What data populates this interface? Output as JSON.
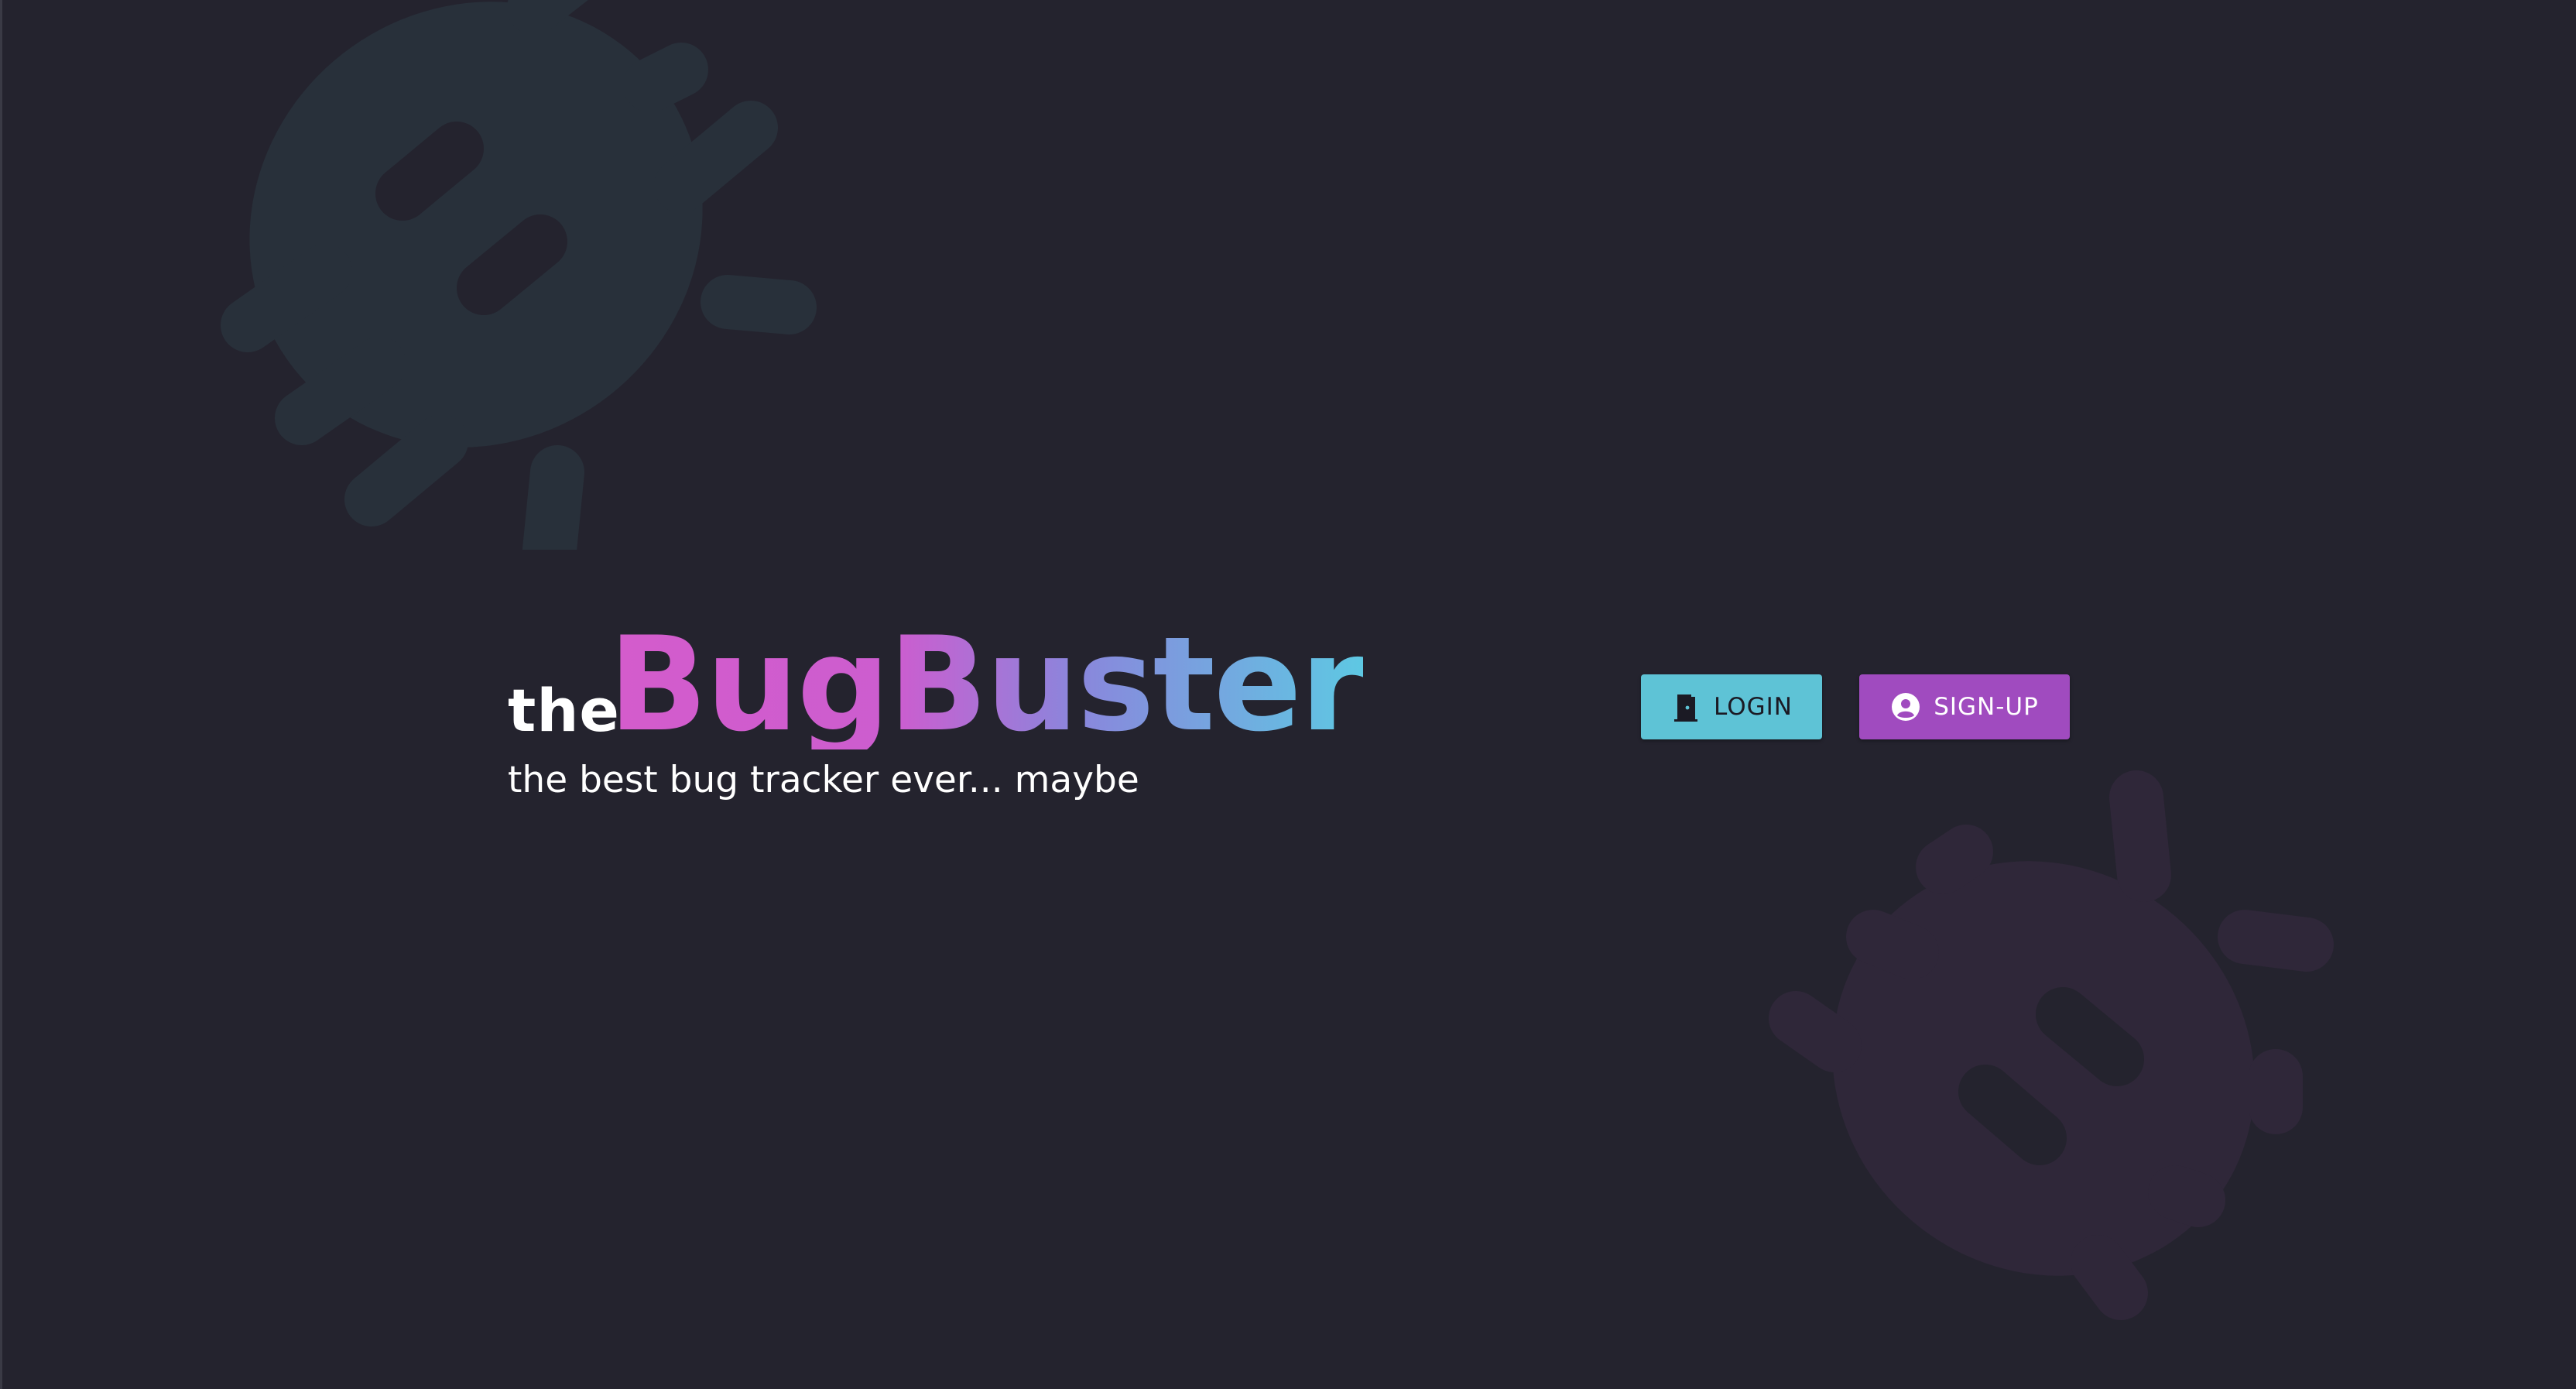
{
  "brand": {
    "prefix": "the",
    "name": "BugBuster",
    "tagline": "the best bug tracker ever... maybe",
    "gradient": [
      "#d45ccc",
      "#cc5dcf",
      "#8a86dc",
      "#5ec8e3"
    ]
  },
  "actions": {
    "login": {
      "label": "LOGIN",
      "icon": "door-icon",
      "color": "#5ec3d6"
    },
    "signup": {
      "label": "SIGN-UP",
      "icon": "account-circle-icon",
      "color": "#a04bbf"
    }
  },
  "decorations": {
    "bug_top_color": "#28303a",
    "bug_bottom_color": "#2f2739",
    "background": "#24232e"
  }
}
